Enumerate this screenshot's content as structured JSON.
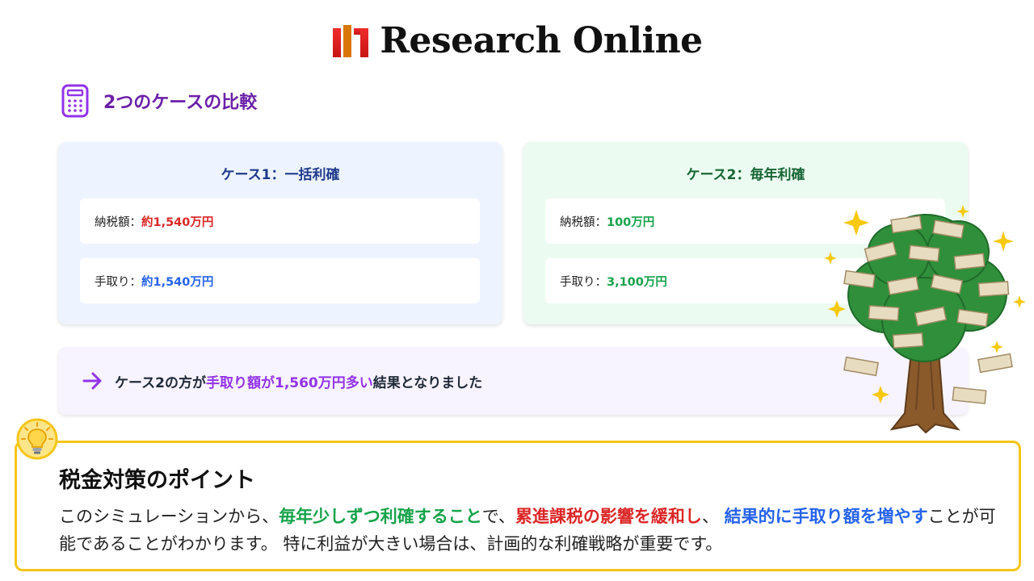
{
  "header": {
    "brand": "Research Online",
    "icon": "research-online-logo-mark",
    "brand_colors": [
      "#e11d1d",
      "#d97706"
    ]
  },
  "comparison": {
    "icon": "calculator-icon",
    "title": "2つのケースの比較",
    "case1": {
      "title": "ケース1：一括利確",
      "tax_label": "納税額：",
      "tax_value": "約1,540万円",
      "net_label": "手取り：",
      "net_value": "約1,540万円"
    },
    "case2": {
      "title": "ケース2：毎年利確",
      "tax_label": "納税額：",
      "tax_value": "100万円",
      "net_label": "手取り：",
      "net_value": "3,100万円"
    }
  },
  "result": {
    "icon": "arrow-right-icon",
    "part1": "ケース2の方が",
    "highlight": "手取り額が1,560万円多い",
    "part2": "結果となりました"
  },
  "illustration": {
    "icon": "money-tree-illustration"
  },
  "point": {
    "icon": "lightbulb-icon",
    "title": "税金対策のポイント",
    "t1": "このシミュレーションから、",
    "h1": "毎年少しずつ利確すること",
    "t2": "で、",
    "h2": "累進課税の影響を緩和し",
    "t3": "、 ",
    "h3": "結果的に手取り額を増やす",
    "t4": "ことが可能であることがわかります。 特に利益が大きい場合は、計画的な利確戦略が重要です。"
  },
  "colors": {
    "accent_purple": "#6b21a8",
    "tax_red": "#dc2626",
    "net_blue": "#2563eb",
    "green": "#16a34a",
    "point_border": "#f5c518"
  }
}
